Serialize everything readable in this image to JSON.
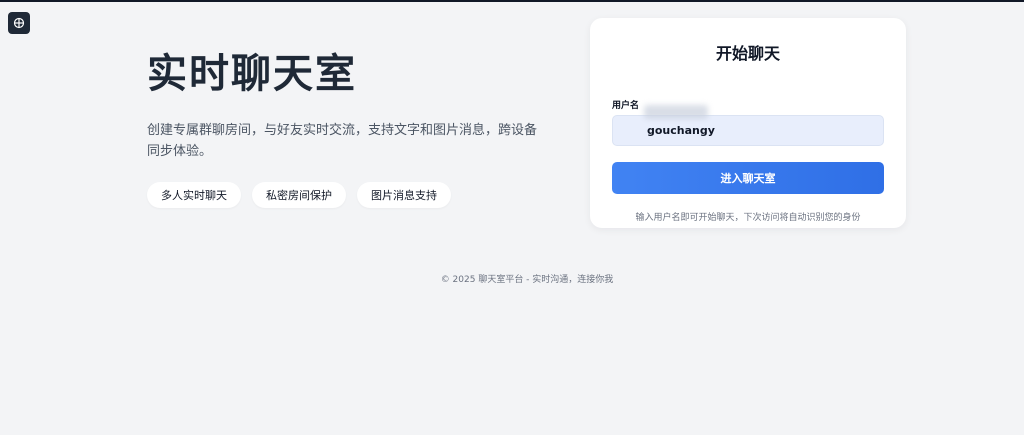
{
  "hero": {
    "title": "实时聊天室",
    "description": "创建专属群聊房间，与好友实时交流，支持文字和图片消息，跨设备同步体验。",
    "features": [
      "多人实时聊天",
      "私密房间保护",
      "图片消息支持"
    ]
  },
  "login_card": {
    "title": "开始聊天",
    "username_label": "用户名",
    "username_value": "gouchangy",
    "enter_button_label": "进入聊天室",
    "hint": "输入用户名即可开始聊天，下次访问将自动识别您的身份"
  },
  "footer": {
    "text": "© 2025 聊天室平台 - 实时沟通，连接你我"
  },
  "icons": {
    "app_badge": "app-icon"
  },
  "colors": {
    "accent": "#3b82f6",
    "background": "#f3f4f6",
    "input_background": "#e8eefc"
  }
}
